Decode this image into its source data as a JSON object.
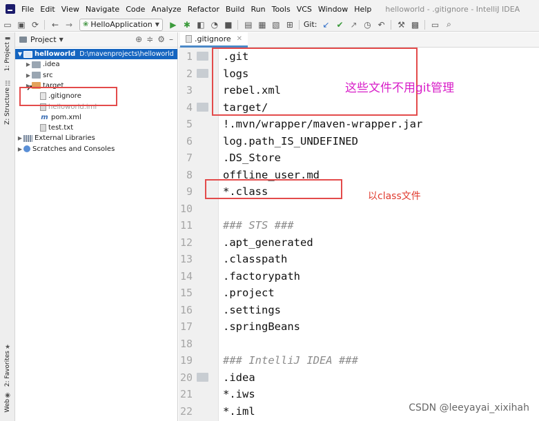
{
  "window": {
    "title": "helloworld - .gitignore - IntelliJ IDEA"
  },
  "menu": [
    {
      "id": "file",
      "label": "File"
    },
    {
      "id": "edit",
      "label": "Edit"
    },
    {
      "id": "view",
      "label": "View"
    },
    {
      "id": "navigate",
      "label": "Navigate"
    },
    {
      "id": "code",
      "label": "Code"
    },
    {
      "id": "analyze",
      "label": "Analyze"
    },
    {
      "id": "refactor",
      "label": "Refactor"
    },
    {
      "id": "build",
      "label": "Build"
    },
    {
      "id": "run",
      "label": "Run"
    },
    {
      "id": "tools",
      "label": "Tools"
    },
    {
      "id": "vcs",
      "label": "VCS"
    },
    {
      "id": "window",
      "label": "Window"
    },
    {
      "id": "help",
      "label": "Help"
    }
  ],
  "toolbar": {
    "run_config": "HelloApplication",
    "git_label": "Git:"
  },
  "stripe": {
    "project_tab": "1: Project",
    "structure_tab": "Z: Structure",
    "favorites_tab": "2: Favorites",
    "web_tab": "Web"
  },
  "project_panel": {
    "title": "Project",
    "tree": [
      {
        "label": "helloworld",
        "path": "D:\\mavenprojects\\helloworld",
        "icon": "folder-blue",
        "arrow": "▼",
        "indent": 0,
        "selected": true,
        "muted": false
      },
      {
        "label": ".idea",
        "icon": "folder-gray",
        "arrow": "▶",
        "indent": 1,
        "selected": false,
        "muted": false
      },
      {
        "label": "src",
        "icon": "folder-gray",
        "arrow": "▶",
        "indent": 1,
        "selected": false,
        "muted": false
      },
      {
        "label": "target",
        "icon": "folder-orange",
        "arrow": "▶",
        "indent": 1,
        "selected": false,
        "muted": false
      },
      {
        "label": ".gitignore",
        "icon": "file-gitignore",
        "arrow": "",
        "indent": 2,
        "selected": false,
        "muted": false
      },
      {
        "label": "helloworld.iml",
        "icon": "file",
        "arrow": "",
        "indent": 2,
        "selected": false,
        "muted": true
      },
      {
        "label": "pom.xml",
        "icon": "maven-m",
        "arrow": "",
        "indent": 2,
        "selected": false,
        "muted": false
      },
      {
        "label": "test.txt",
        "icon": "file",
        "arrow": "",
        "indent": 2,
        "selected": false,
        "muted": false
      },
      {
        "label": "External Libraries",
        "icon": "library",
        "arrow": "▶",
        "indent": 0,
        "selected": false,
        "muted": false
      },
      {
        "label": "Scratches and Consoles",
        "icon": "scratch",
        "arrow": "▶",
        "indent": 0,
        "selected": false,
        "muted": false
      }
    ]
  },
  "editor": {
    "tab_label": ".gitignore",
    "lines": [
      {
        "num": "1",
        "text": ".git",
        "fold": true,
        "comment": false
      },
      {
        "num": "2",
        "text": "logs",
        "fold": true,
        "comment": false
      },
      {
        "num": "3",
        "text": "rebel.xml",
        "fold": false,
        "comment": false
      },
      {
        "num": "4",
        "text": "target/",
        "fold": true,
        "comment": false
      },
      {
        "num": "5",
        "text": "!.mvn/wrapper/maven-wrapper.jar",
        "fold": false,
        "comment": false
      },
      {
        "num": "6",
        "text": "log.path_IS_UNDEFINED",
        "fold": false,
        "comment": false
      },
      {
        "num": "7",
        "text": ".DS_Store",
        "fold": false,
        "comment": false
      },
      {
        "num": "8",
        "text": "offline_user.md",
        "fold": false,
        "comment": false
      },
      {
        "num": "9",
        "text": "*.class",
        "fold": false,
        "comment": false
      },
      {
        "num": "10",
        "text": "",
        "fold": false,
        "comment": false
      },
      {
        "num": "11",
        "text": "### STS ###",
        "fold": false,
        "comment": true
      },
      {
        "num": "12",
        "text": ".apt_generated",
        "fold": false,
        "comment": false
      },
      {
        "num": "13",
        "text": ".classpath",
        "fold": false,
        "comment": false
      },
      {
        "num": "14",
        "text": ".factorypath",
        "fold": false,
        "comment": false
      },
      {
        "num": "15",
        "text": ".project",
        "fold": false,
        "comment": false
      },
      {
        "num": "16",
        "text": ".settings",
        "fold": false,
        "comment": false
      },
      {
        "num": "17",
        "text": ".springBeans",
        "fold": false,
        "comment": false
      },
      {
        "num": "18",
        "text": "",
        "fold": false,
        "comment": false
      },
      {
        "num": "19",
        "text": "### IntelliJ IDEA ###",
        "fold": false,
        "comment": true
      },
      {
        "num": "20",
        "text": ".idea",
        "fold": true,
        "comment": false
      },
      {
        "num": "21",
        "text": "*.iws",
        "fold": false,
        "comment": false
      },
      {
        "num": "22",
        "text": "*.iml",
        "fold": false,
        "comment": false
      }
    ]
  },
  "annotations": {
    "note_top": "这些文件不用git管理",
    "note_class": "以class文件",
    "watermark": "CSDN @leeyayai_xixihah"
  },
  "colors": {
    "annotation_box": "#e34a4a",
    "note_magenta": "#d81ec8",
    "note_red": "#e03a2e",
    "selection": "#1565c0"
  }
}
